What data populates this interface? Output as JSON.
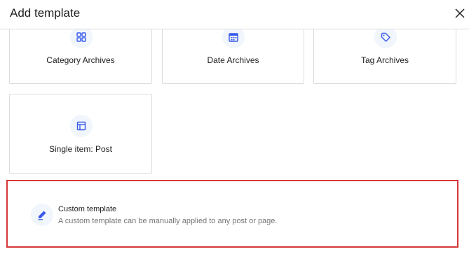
{
  "dialog": {
    "title": "Add template",
    "close_icon": "close-icon"
  },
  "cards": [
    {
      "label": "Category Archives",
      "icon": "category-grid-icon"
    },
    {
      "label": "Date Archives",
      "icon": "calendar-icon"
    },
    {
      "label": "Tag Archives",
      "icon": "tag-icon"
    },
    {
      "label": "Single item: Post",
      "icon": "post-layout-icon"
    }
  ],
  "custom_template": {
    "title": "Custom template",
    "description": "A custom template can be manually applied to any post or page.",
    "icon": "pencil-icon",
    "highlight_color": "#d63638"
  },
  "colors": {
    "accent": "#3858e9",
    "icon_bg": "#f0f6fc",
    "border": "#dcdcde"
  }
}
